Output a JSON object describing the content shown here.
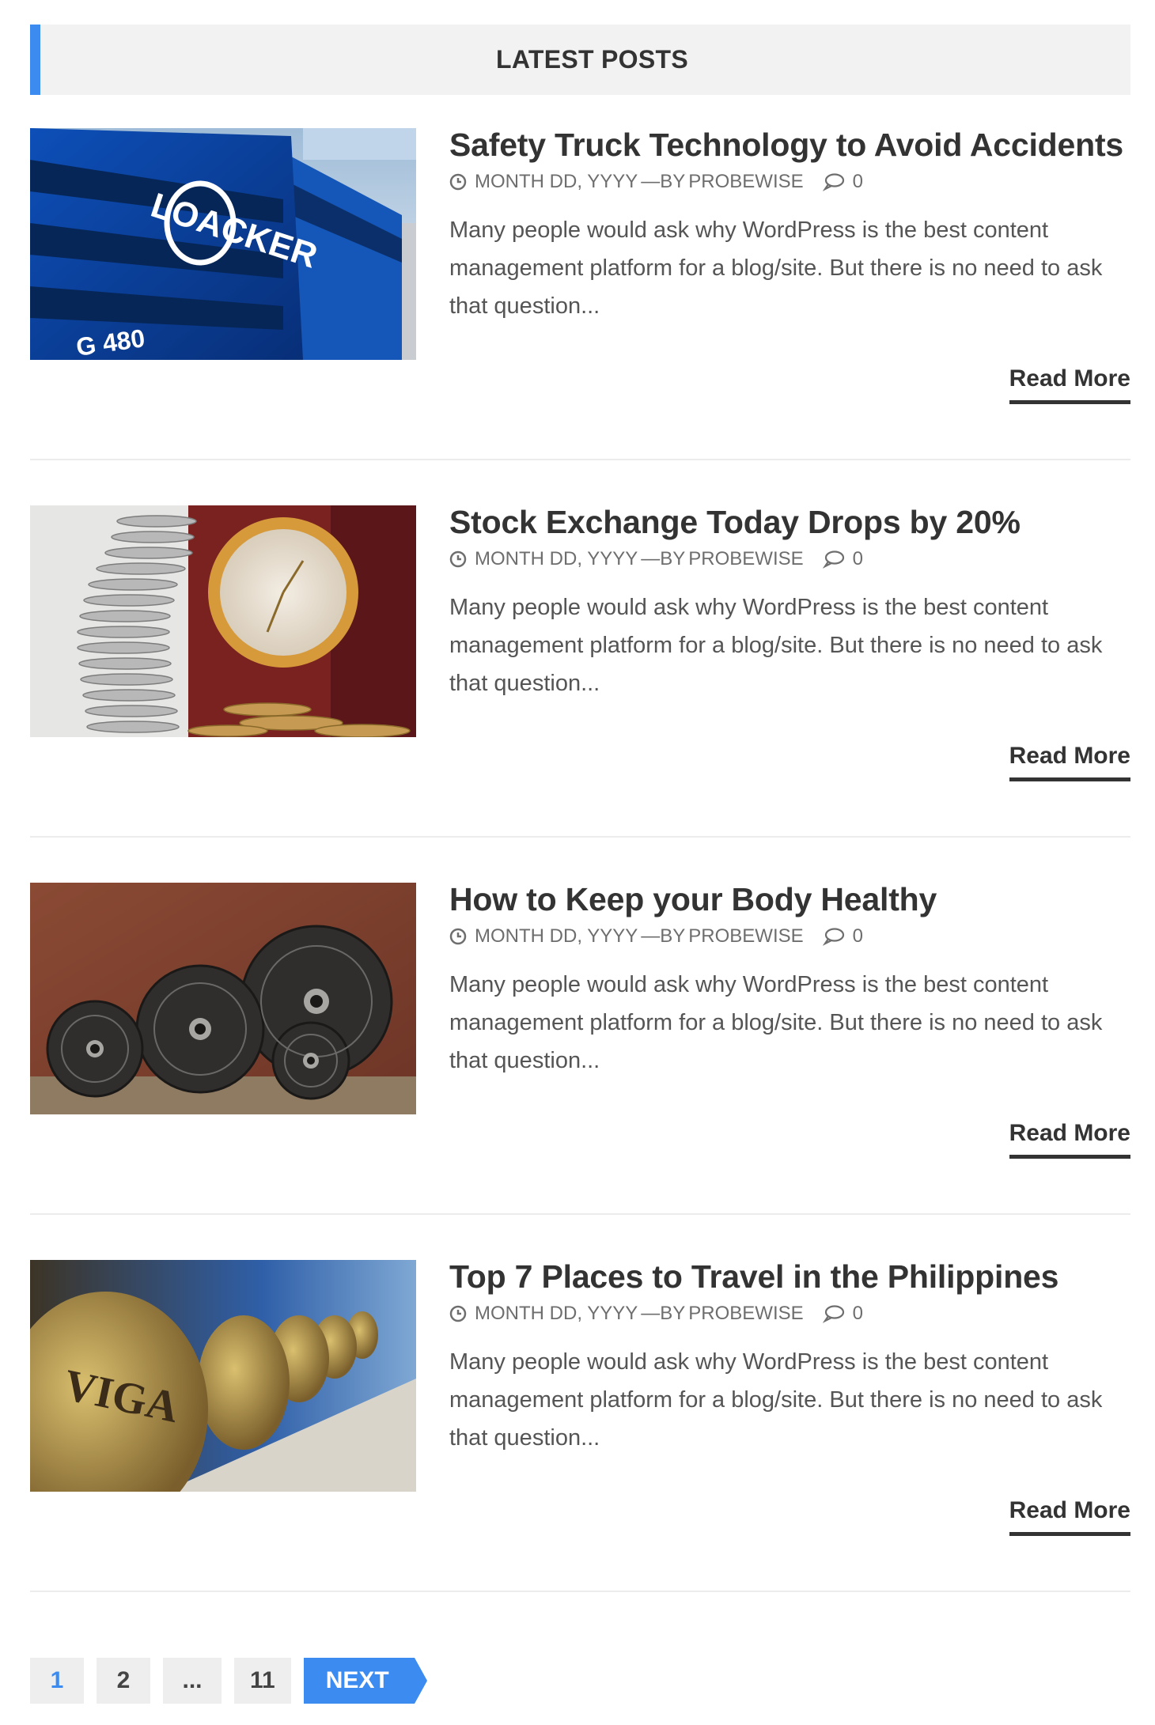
{
  "section": {
    "title": "LATEST POSTS",
    "accent_color": "#3b8bf0"
  },
  "posts": [
    {
      "title": "Safety Truck Technology to Avoid Accidents",
      "date": "MONTH DD, YYYY",
      "author_sep": "—BY",
      "author": "PROBEWISE",
      "comments": "0",
      "excerpt": "Many people would ask why WordPress is the best content management platform for a blog/site. But there is no need to ask that question...",
      "read_more": "Read More",
      "image": "blue-trucks-image"
    },
    {
      "title": "Stock Exchange Today Drops by 20%",
      "date": "MONTH DD, YYYY",
      "author_sep": "—BY",
      "author": "PROBEWISE",
      "comments": "0",
      "excerpt": "Many people would ask why WordPress is the best content management platform for a blog/site. But there is no need to ask that question...",
      "read_more": "Read More",
      "image": "coins-and-clock-image"
    },
    {
      "title": "How to Keep your Body Healthy",
      "date": "MONTH DD, YYYY",
      "author_sep": "—BY",
      "author": "PROBEWISE",
      "comments": "0",
      "excerpt": "Many people would ask why WordPress is the best content management platform for a blog/site. But there is no need to ask that question...",
      "read_more": "Read More",
      "image": "weight-plates-image"
    },
    {
      "title": "Top 7 Places to Travel in the Philippines",
      "date": "MONTH DD, YYYY",
      "author_sep": "—BY",
      "author": "PROBEWISE",
      "comments": "0",
      "excerpt": "Many people would ask why WordPress is the best content management platform for a blog/site. But there is no need to ask that question...",
      "read_more": "Read More",
      "image": "clay-jars-image"
    }
  ],
  "pagination": {
    "pages": [
      "1",
      "2",
      "...",
      "11"
    ],
    "current": "1",
    "next_label": "NEXT"
  }
}
